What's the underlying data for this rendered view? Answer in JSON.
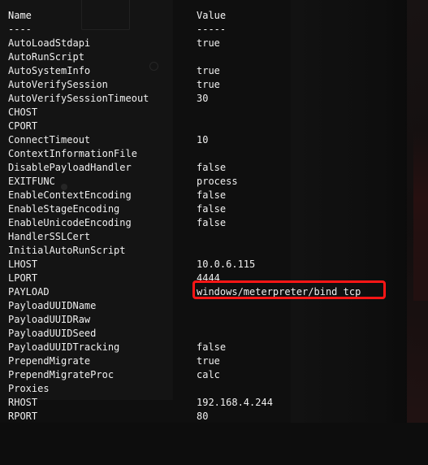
{
  "colors": {
    "text": "#f0f0f0",
    "highlight": "#ff1616",
    "background": "#0d0d0d"
  },
  "terminal": {
    "header": {
      "name": "Name",
      "value": "Value"
    },
    "divider": {
      "name": "----",
      "value": "-----"
    },
    "rows": [
      {
        "name": "AutoLoadStdapi",
        "value": "true"
      },
      {
        "name": "AutoRunScript",
        "value": ""
      },
      {
        "name": "AutoSystemInfo",
        "value": "true"
      },
      {
        "name": "AutoVerifySession",
        "value": "true"
      },
      {
        "name": "AutoVerifySessionTimeout",
        "value": "30"
      },
      {
        "name": "CHOST",
        "value": ""
      },
      {
        "name": "CPORT",
        "value": ""
      },
      {
        "name": "ConnectTimeout",
        "value": "10"
      },
      {
        "name": "ContextInformationFile",
        "value": ""
      },
      {
        "name": "DisablePayloadHandler",
        "value": "false"
      },
      {
        "name": "EXITFUNC",
        "value": "process"
      },
      {
        "name": "EnableContextEncoding",
        "value": "false"
      },
      {
        "name": "EnableStageEncoding",
        "value": "false"
      },
      {
        "name": "EnableUnicodeEncoding",
        "value": "false"
      },
      {
        "name": "HandlerSSLCert",
        "value": ""
      },
      {
        "name": "InitialAutoRunScript",
        "value": ""
      },
      {
        "name": "LHOST",
        "value": "10.0.6.115"
      },
      {
        "name": "LPORT",
        "value": "4444"
      },
      {
        "name": "PAYLOAD",
        "value": "windows/meterpreter/bind_tcp"
      },
      {
        "name": "PayloadUUIDName",
        "value": ""
      },
      {
        "name": "PayloadUUIDRaw",
        "value": ""
      },
      {
        "name": "PayloadUUIDSeed",
        "value": ""
      },
      {
        "name": "PayloadUUIDTracking",
        "value": "false"
      },
      {
        "name": "PrependMigrate",
        "value": "true"
      },
      {
        "name": "PrependMigrateProc",
        "value": "calc"
      },
      {
        "name": "Proxies",
        "value": ""
      },
      {
        "name": "RHOST",
        "value": "192.168.4.244"
      },
      {
        "name": "RPORT",
        "value": "80"
      }
    ]
  }
}
